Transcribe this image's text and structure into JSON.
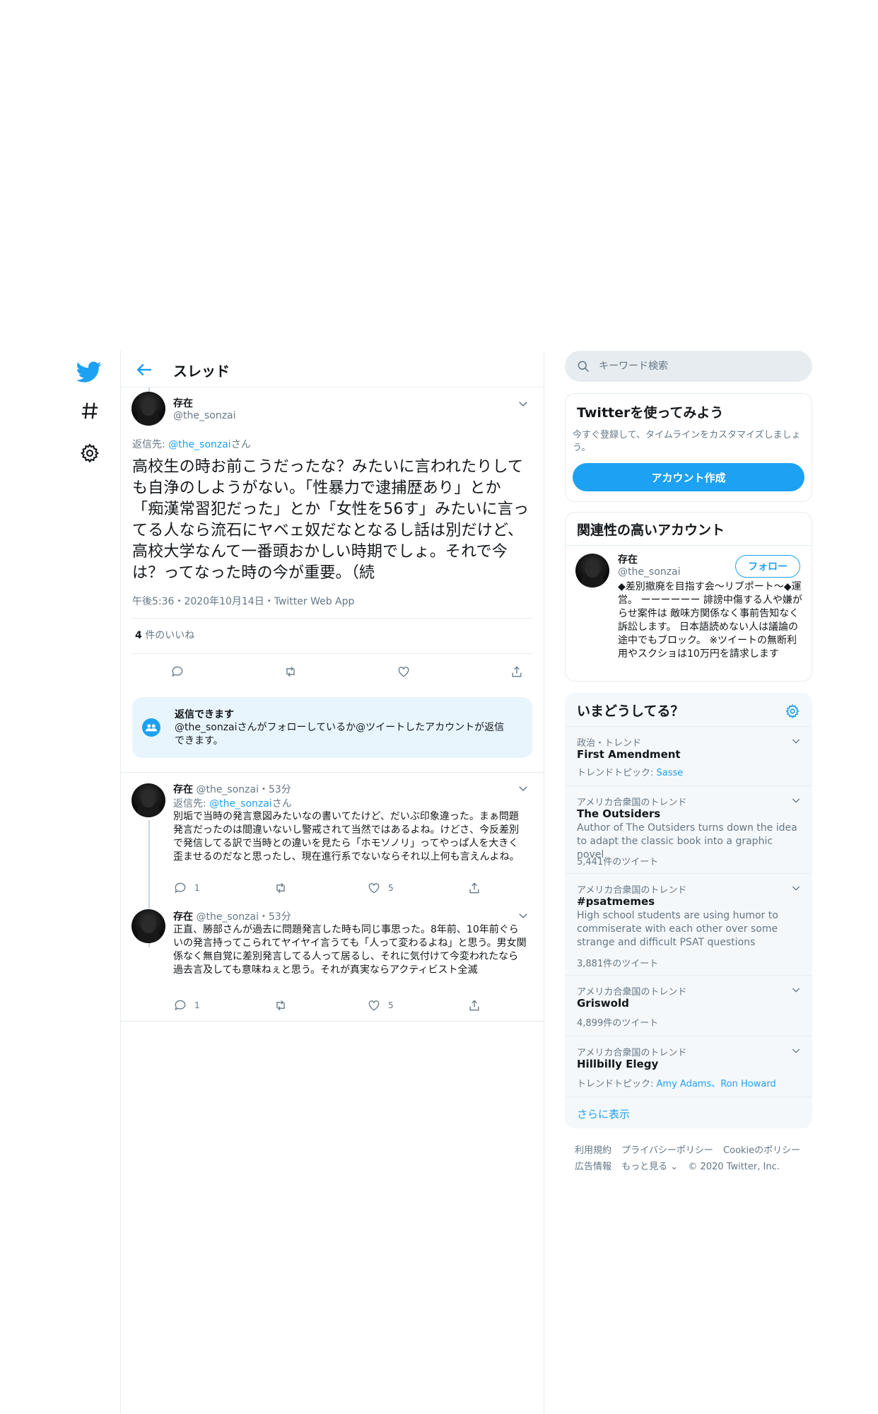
{
  "nav": {
    "logo_icon": "twitter-bird-icon",
    "explore_icon": "hashtag-icon",
    "settings_icon": "gear-icon"
  },
  "header": {
    "title": "スレッド",
    "back_icon": "arrow-left-icon"
  },
  "main_tweet": {
    "name": "存在",
    "handle": "@the_sonzai",
    "reply_to_prefix": "返信先: ",
    "reply_to_handle": "@the_sonzai",
    "reply_to_suffix": "さん",
    "text": "高校生の時お前こうだったな？みたいに言われたりしても自浄のしようがない。「性暴力で逮捕歴あり」とか「痴漢常習犯だった」とか「女性を56す」みたいに言ってる人なら流石にヤベェ奴だなとなるし話は別だけど、高校大学なんて一番頭おかしい時期でしょ。それで今は？ってなった時の今が重要。（続",
    "meta": "午後5:36・2020年10月14日・Twitter Web App",
    "likes_count": "4",
    "likes_label": " 件のいいね"
  },
  "reply_notice": {
    "title": "返信できます",
    "body": "@the_sonzaiさんがフォローしているか@ツイートしたアカウントが返信できます。",
    "icon": "people-icon"
  },
  "replies": [
    {
      "name": "存在",
      "handle": "@the_sonzai",
      "time": "・53分",
      "reply_to_prefix": "返信先: ",
      "reply_to_handle": "@the_sonzai",
      "reply_to_suffix": "さん",
      "text": "別垢で当時の発言意図みたいなの書いてたけど、だいぶ印象違った。まぁ問題発言だったのは間違いないし警戒されて当然ではあるよね。けどさ、今反差別で発信してる訳で当時との違いを見たら「ホモソノリ」ってやっぱ人を大きく歪ませるのだなと思ったし、現在進行系でないならそれ以上何も言えんよね。",
      "reply_count": "1",
      "like_count": "5"
    },
    {
      "name": "存在",
      "handle": "@the_sonzai",
      "time": "・53分",
      "text": "正直、勝部さんが過去に問題発言した時も同じ事思った。8年前、10年前ぐらいの発言持ってこられてヤイヤイ言うても「人って変わるよね」と思う。男女関係なく無自覚に差別発言してる人って居るし、それに気付けて今変われたなら過去言及しても意味ねぇと思う。それが真実ならアクティビスト全滅",
      "reply_count": "1",
      "like_count": "5"
    }
  ],
  "search": {
    "placeholder": "キーワード検索"
  },
  "signup": {
    "title": "Twitterを使ってみよう",
    "desc": "今すぐ登録して、タイムラインをカスタマイズしましょう。",
    "button": "アカウント作成"
  },
  "related": {
    "title": "関連性の高いアカウント",
    "name": "存在",
    "handle": "@the_sonzai",
    "follow": "フォロー",
    "bio": "◆差別撤廃を目指す会〜リブポート〜◆運営。 ーーーーーー 誹謗中傷する人や嫌がらせ案件は 敵味方関係なく事前告知なく訴訟します。 日本語読めない人は議論の途中でもブロック。 ※ツイートの無断利用やスクショは10万円を請求します"
  },
  "trends": {
    "title": "いまどうしてる？",
    "items": [
      {
        "context": "政治・トレンド",
        "name": "First Amendment",
        "topic_prefix": "トレンドトピック: ",
        "topic_link": "Sasse"
      },
      {
        "context": "アメリカ合衆国のトレンド",
        "name": "The Outsiders",
        "desc": "Author of The Outsiders turns down the idea to adapt the classic book into a graphic novel",
        "count": "5,441件のツイート"
      },
      {
        "context": "アメリカ合衆国のトレンド",
        "name": "#psatmemes",
        "desc": "High school students are using humor to commiserate with each other over some strange and difficult PSAT questions",
        "count": "3,881件のツイート"
      },
      {
        "context": "アメリカ合衆国のトレンド",
        "name": "Griswold",
        "count": "4,899件のツイート"
      },
      {
        "context": "アメリカ合衆国のトレンド",
        "name": "Hillbilly Elegy",
        "topic_prefix": "トレンドトピック: ",
        "topic_link": "Amy Adams、Ron Howard"
      }
    ],
    "show_more": "さらに表示"
  },
  "footer": {
    "links_row1": [
      "利用規約",
      "プライバシーポリシー",
      "Cookieのポリシー"
    ],
    "links_row2": [
      "広告情報",
      "もっと見る ⌄",
      "© 2020 Twitter, Inc."
    ]
  },
  "colors": {
    "accent": "#1da1f2",
    "muted": "#657786",
    "border": "#e6ecf0",
    "panel": "#f5f8fa"
  }
}
